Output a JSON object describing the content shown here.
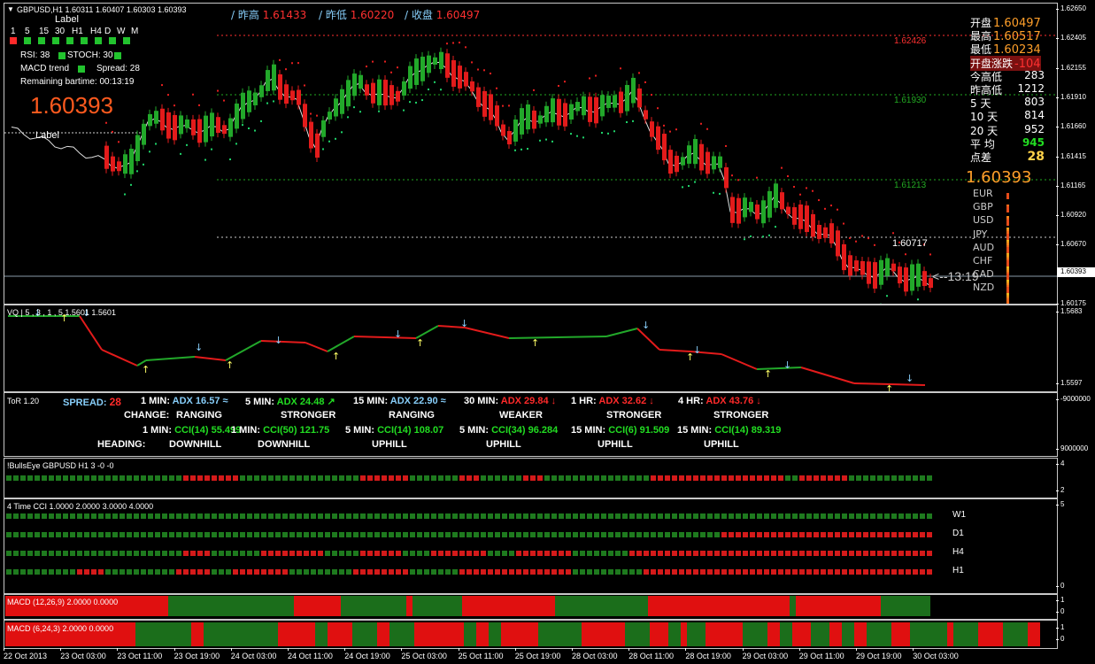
{
  "chart": {
    "symbol_header": "GBPUSD,H1  1.60311 1.60407 1.60303 1.60393",
    "hi_label": "/ 昨高",
    "hi_val": "1.61433",
    "lo_label": "/ 昨低",
    "lo_val": "1.60220",
    "close_label": "/ 收盘",
    "close_val": "1.60497",
    "label_top": "Label",
    "label_bottom": "Label",
    "timeframes": [
      "1",
      "5",
      "15",
      "30",
      "H1",
      "H4",
      "D",
      "W",
      "M"
    ],
    "rsi": "RSI: 38",
    "stoch": "STOCH: 30",
    "macd_trend": "MACD trend",
    "spread": "Spread: 28",
    "remaining": "Remaining bartime:  00:13:19",
    "big_price": "1.60393",
    "level_1": "1.62426",
    "level_2": "1.61930",
    "level_3": "1.61213",
    "level_4": "1.60717",
    "countdown": "<--13:19",
    "right_panel": [
      {
        "label": "开盘",
        "value": "1.60497",
        "color": "#ff9f2a"
      },
      {
        "label": "最高",
        "value": "1.60517",
        "color": "#ff9f2a"
      },
      {
        "label": "最低",
        "value": "1.60234",
        "color": "#ff9f2a"
      },
      {
        "label": "开盘涨跌",
        "value": "-104",
        "color": "#ff3030"
      },
      {
        "label": "今高低",
        "value": "283",
        "color": "#ffffff"
      },
      {
        "label": "昨高低",
        "value": "1212",
        "color": "#ffffff"
      },
      {
        "label": "5 天",
        "value": "803",
        "color": "#ffffff"
      },
      {
        "label": "10 天",
        "value": "814",
        "color": "#ffffff"
      },
      {
        "label": "20 天",
        "value": "952",
        "color": "#ffffff"
      },
      {
        "label": "平 均",
        "value": "945",
        "color": "#22dd22"
      },
      {
        "label": "点差",
        "value": "28",
        "color": "#ffd24a"
      }
    ],
    "rp_big_price": "1.60393",
    "currencies": [
      "EUR",
      "GBP",
      "USD",
      "JPY",
      "AUD",
      "CHF",
      "CAD",
      "NZD"
    ],
    "price_axis": [
      "1.62650",
      "1.62405",
      "1.62155",
      "1.61910",
      "1.61660",
      "1.61415",
      "1.61165",
      "1.60920",
      "1.60670",
      "1.60393",
      "1.60175"
    ],
    "current_price_tag": "1.60393"
  },
  "vq": {
    "title": "VQ | 5 , 3 , 1 , 5",
    "values": "1.5601 1.5601",
    "axis_top": "1.5683",
    "axis_bottom": "1.5597"
  },
  "tor": {
    "title": "ToR 1.20",
    "axis_top": "-9000000",
    "axis_bottom": "9000000",
    "spread_label": "SPREAD:",
    "spread_val": "28",
    "change_label": "CHANGE:",
    "heading_label": "HEADING:",
    "adx": [
      {
        "tf": "1 MIN:",
        "val": "ADX 16.57",
        "arrow": "≈",
        "change": "RANGING",
        "color": "#87cefa"
      },
      {
        "tf": "5 MIN:",
        "val": "ADX 24.48",
        "arrow": "↗",
        "change": "STRONGER",
        "color": "#22dd22"
      },
      {
        "tf": "15 MIN:",
        "val": "ADX 22.90",
        "arrow": "≈",
        "change": "RANGING",
        "color": "#87cefa"
      },
      {
        "tf": "30 MIN:",
        "val": "ADX 29.84",
        "arrow": "↓",
        "change": "WEAKER",
        "color": "#ff2a2a"
      },
      {
        "tf": "1 HR:",
        "val": "ADX 32.62",
        "arrow": "↓",
        "change": "STRONGER",
        "color": "#ff2a2a"
      },
      {
        "tf": "4 HR:",
        "val": "ADX 43.76",
        "arrow": "↓",
        "change": "STRONGER",
        "color": "#ff2a2a"
      }
    ],
    "cci": [
      {
        "tf": "1 MIN:",
        "val": "CCI(14) 55.499",
        "heading": "DOWNHILL"
      },
      {
        "tf": "1 MIN:",
        "val": "CCI(50) 121.75",
        "heading": "DOWNHILL"
      },
      {
        "tf": "5 MIN:",
        "val": "CCI(14) 108.07",
        "heading": "UPHILL"
      },
      {
        "tf": "5 MIN:",
        "val": "CCI(34) 96.284",
        "heading": "UPHILL"
      },
      {
        "tf": "15 MIN:",
        "val": "CCI(6) 91.509",
        "heading": "UPHILL"
      },
      {
        "tf": "15 MIN:",
        "val": "CCI(14) 89.319",
        "heading": "UPHILL"
      }
    ]
  },
  "bullseye": {
    "title": "!BullsEye GBPUSD H1 3 -0 -0",
    "axis_top": "4",
    "axis_bottom": "2"
  },
  "cci4": {
    "title": "4 Time CCI 1.0000 2.0000 3.0000 4.0000",
    "axis_top": "5",
    "axis_bottom": "0",
    "rows": [
      "W1",
      "D1",
      "H4",
      "H1"
    ]
  },
  "macd1": {
    "title": "MACD (12,26,9) 2.0000 0.0000",
    "axis_top": "1",
    "axis_bottom": "0"
  },
  "macd2": {
    "title": "MACD (6,24,3) 2.0000 0.0000",
    "axis_top": "1",
    "axis_bottom": "0"
  },
  "time_axis": [
    "22 Oct 2013",
    "23 Oct 03:00",
    "23 Oct 11:00",
    "23 Oct 19:00",
    "24 Oct 03:00",
    "24 Oct 11:00",
    "24 Oct 19:00",
    "25 Oct 03:00",
    "25 Oct 11:00",
    "25 Oct 19:00",
    "28 Oct 03:00",
    "28 Oct 11:00",
    "28 Oct 19:00",
    "29 Oct 03:00",
    "29 Oct 11:00",
    "29 Oct 19:00",
    "30 Oct 03:00"
  ],
  "colors": {
    "bull": "#22a82a",
    "bear": "#e31b1b",
    "dot_green": "#1fd36a",
    "dot_red": "#e51f1f",
    "grid": "#c8c8c8"
  }
}
